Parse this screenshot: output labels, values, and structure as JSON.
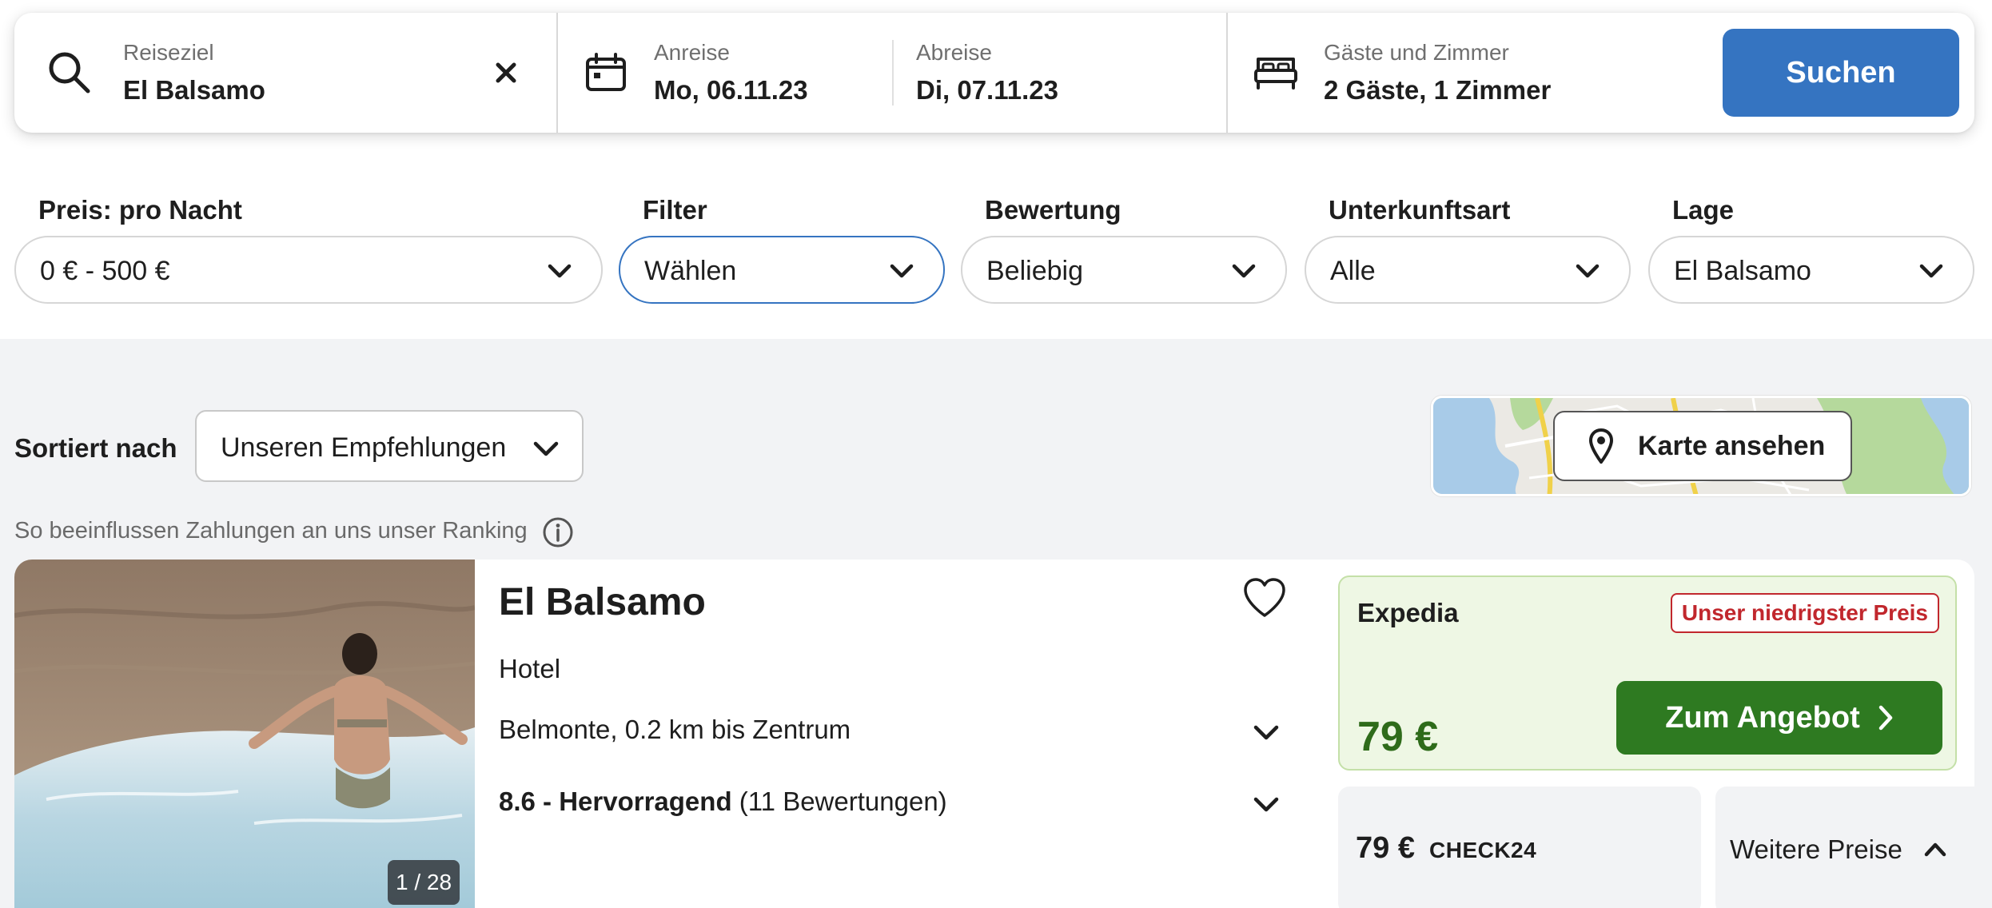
{
  "search": {
    "destination_label": "Reiseziel",
    "destination_value": "El Balsamo",
    "checkin_label": "Anreise",
    "checkin_value": "Mo, 06.11.23",
    "checkout_label": "Abreise",
    "checkout_value": "Di, 07.11.23",
    "guests_label": "Gäste und Zimmer",
    "guests_value": "2 Gäste, 1 Zimmer",
    "button_label": "Suchen",
    "accent_color": "#3574c1"
  },
  "filters": [
    {
      "label": "Preis: pro Nacht",
      "value": "0 € - 500 €"
    },
    {
      "label": "Filter",
      "value": "Wählen"
    },
    {
      "label": "Bewertung",
      "value": "Beliebig"
    },
    {
      "label": "Unterkunftsart",
      "value": "Alle"
    },
    {
      "label": "Lage",
      "value": "El Balsamo"
    }
  ],
  "sort": {
    "label": "Sortiert nach",
    "value": "Unseren Empfehlungen"
  },
  "map": {
    "button_label": "Karte ansehen"
  },
  "ranking_note": "So beeinflussen Zahlungen an uns unser Ranking",
  "hotel": {
    "name": "El Balsamo",
    "type": "Hotel",
    "location": "Belmonte, 0.2 km bis Zentrum",
    "rating_score": "8.6 - Hervorragend",
    "rating_count": "(11 Bewertungen)",
    "image_counter": "1 / 28",
    "deal": {
      "provider": "Expedia",
      "badge": "Unser niedrigster Preis",
      "price": "79 €",
      "button_label": "Zum Angebot",
      "price_color": "#2e6b1a",
      "button_color": "#2e7a21",
      "badge_color": "#c1272d"
    },
    "alt_offer": {
      "price": "79 €",
      "provider": "CHECK24"
    },
    "more_prices_label": "Weitere Preise"
  }
}
